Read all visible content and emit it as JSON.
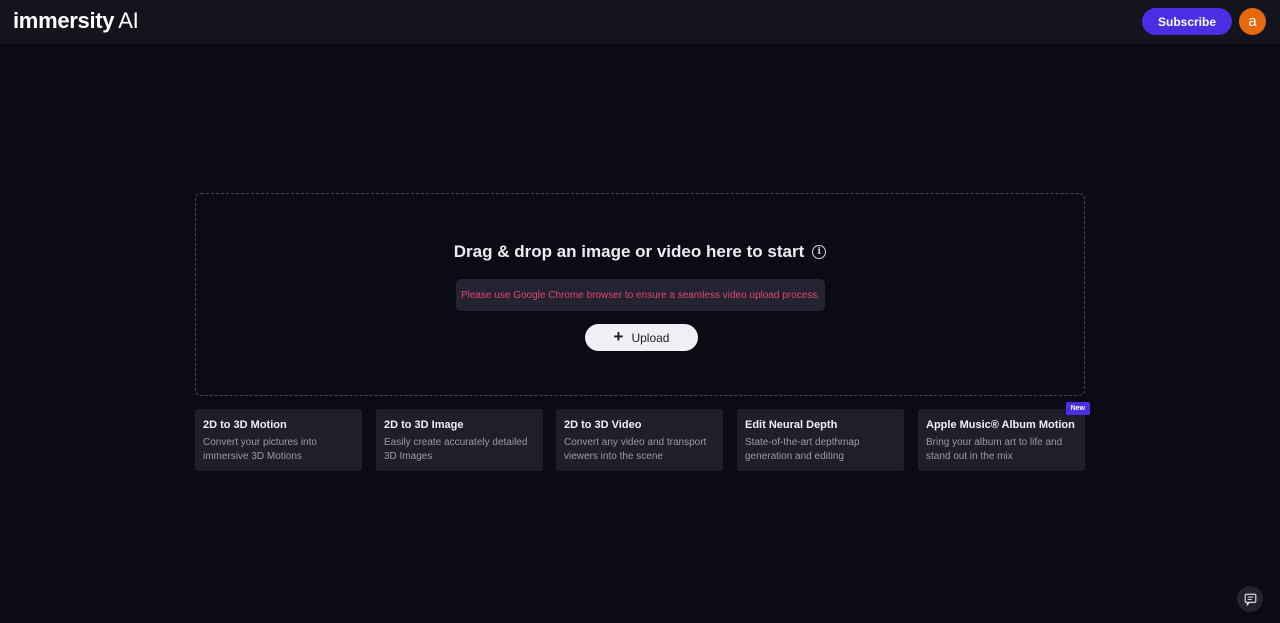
{
  "header": {
    "logo_text": "immersity",
    "logo_suffix": "AI",
    "subscribe_label": "Subscribe",
    "avatar_initial": "a",
    "accent_color": "#4a2ee3",
    "avatar_color": "#e8680e"
  },
  "dropzone": {
    "title": "Drag & drop an image or video here to start",
    "info_icon": "info-icon",
    "warning": "Please use Google Chrome browser to ensure a seamless video upload process.",
    "upload_label": "Upload",
    "upload_icon": "plus-icon"
  },
  "cards": [
    {
      "title": "2D to 3D Motion",
      "desc_line1": "Convert your pictures into",
      "desc_line2": "immersive 3D Motions"
    },
    {
      "title": "2D to 3D Image",
      "desc_line1": "Easily create accurately detailed",
      "desc_line2": "3D Images"
    },
    {
      "title": "2D to 3D Video",
      "desc_line1": "Convert any video and transport",
      "desc_line2": "viewers into the scene"
    },
    {
      "title": "Edit Neural Depth",
      "desc_line1": "State-of-the-art depthmap",
      "desc_line2": "generation and editing"
    },
    {
      "title": "Apple Music® Album Motion",
      "desc_line1": "Bring your album art to life and",
      "desc_line2": "stand out in the mix",
      "badge": "New"
    }
  ],
  "feedback": {
    "icon": "chat-icon"
  }
}
